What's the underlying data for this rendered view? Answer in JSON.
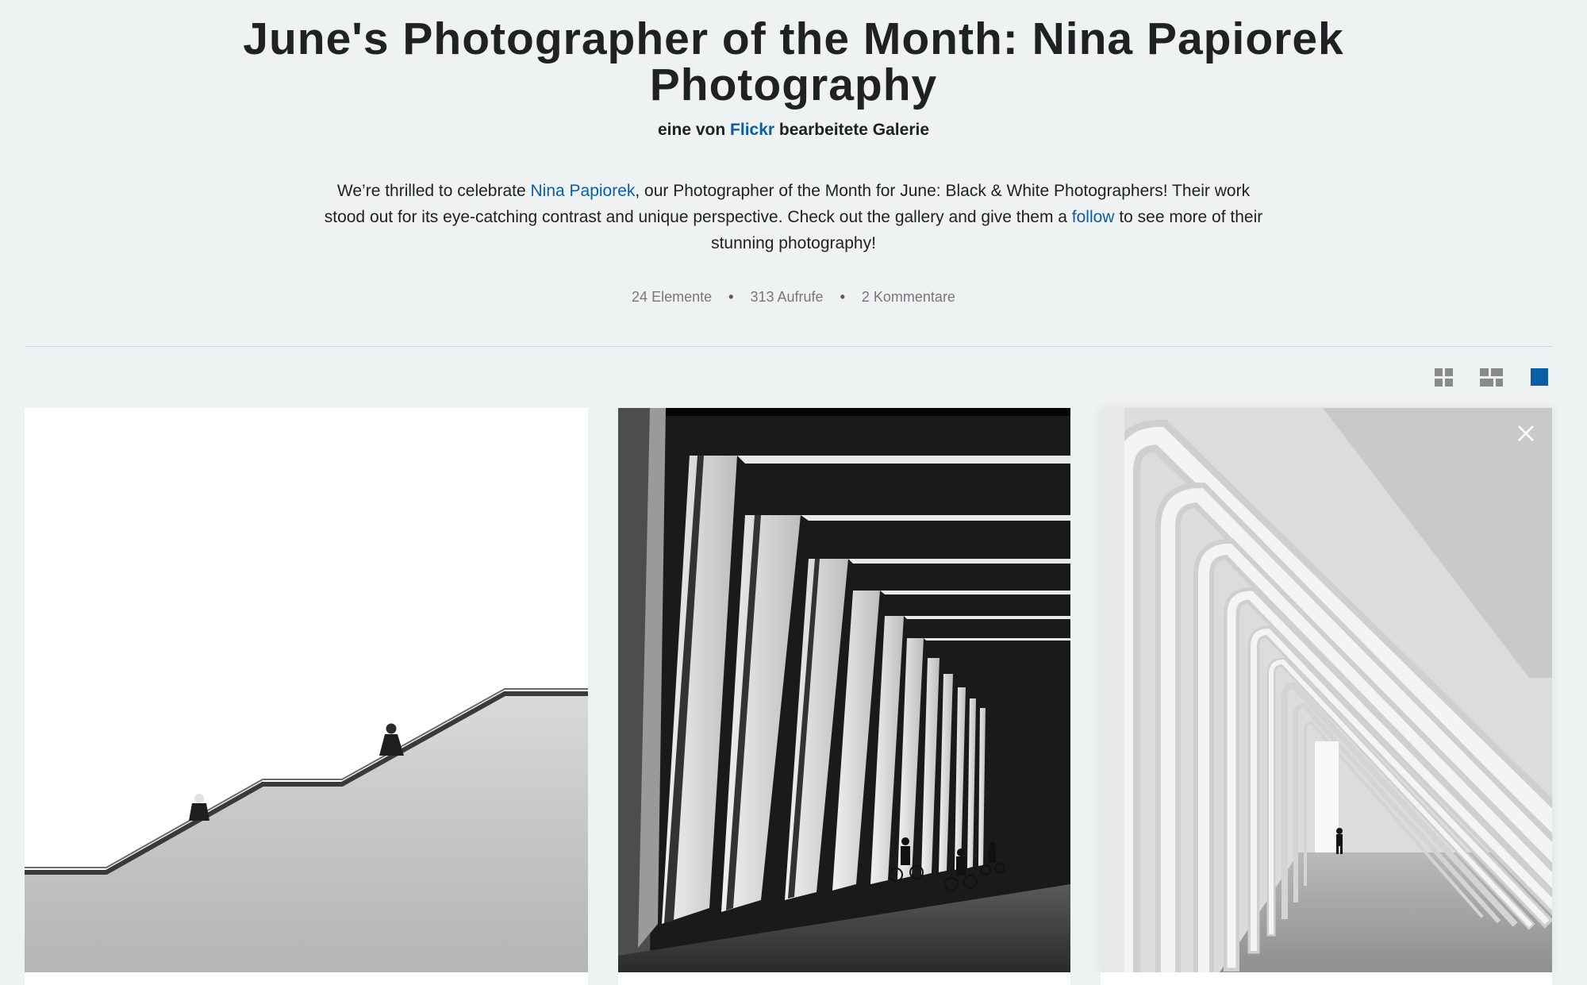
{
  "gallery": {
    "title": "June's Photographer of the Month: Nina Papiorek Photography",
    "curated_prefix": "eine von",
    "curated_by": "Flickr",
    "curated_suffix": "bearbeitete Galerie",
    "description": {
      "part1": "We’re thrilled to celebrate ",
      "photographer_link": "Nina Papiorek",
      "part2": ", our Photographer of the Month for June: Black & White Photographers! Their work stood out for its eye-catching contrast and unique perspective. Check out the gallery and give them a ",
      "follow_link": "follow",
      "part3": " to see more of their stunning photography!"
    },
    "stats": {
      "items": "24 Elemente",
      "views": "313 Aufrufe",
      "comments": "2 Kommentare",
      "separator": "•"
    }
  },
  "view_options": {
    "icons": [
      "small-grid-icon",
      "mixed-grid-icon",
      "large-square-icon"
    ],
    "active_color": "#0a5ea7",
    "inactive_color": "#8a8a8d"
  },
  "photos": [
    {
      "subject": "staircase-silhouettes"
    },
    {
      "subject": "concrete-colonnade-cyclists"
    },
    {
      "subject": "white-arched-corridor"
    }
  ],
  "colors": {
    "background": "#eff2f3",
    "link": "#0a5ea7",
    "text": "#212124",
    "muted_text": "#77777a"
  }
}
